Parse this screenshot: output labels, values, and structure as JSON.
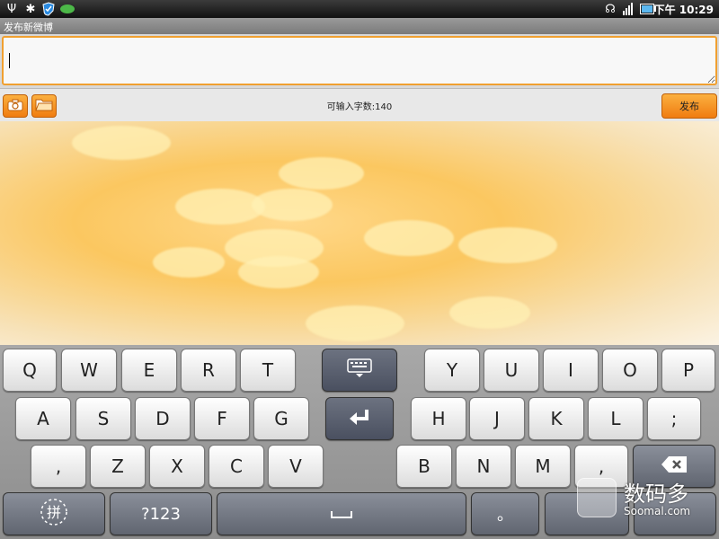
{
  "status_bar": {
    "left_icons": [
      "usb-icon",
      "bug-icon",
      "shield-icon",
      "leaf-icon"
    ],
    "right_icons": [
      "headset-icon",
      "signal-icon",
      "battery-icon"
    ],
    "time": "下午 10:29"
  },
  "title_bar": {
    "title": "发布新微博"
  },
  "compose": {
    "value": "",
    "placeholder": ""
  },
  "toolbar": {
    "camera_icon": "camera-icon",
    "folder_icon": "folder-icon",
    "char_count": "可输入字数:140",
    "publish_label": "发布"
  },
  "keyboard": {
    "row1": [
      "Q",
      "W",
      "E",
      "R",
      "T",
      "Y",
      "U",
      "I",
      "O",
      "P"
    ],
    "row2": [
      "A",
      "S",
      "D",
      "F",
      "G",
      "H",
      "J",
      "K",
      "L",
      ";"
    ],
    "row3": [
      ",",
      "Z",
      "X",
      "C",
      "V",
      "B",
      "N",
      "M",
      ","
    ],
    "symbols_label": "?123",
    "period_label": "。"
  },
  "watermark": {
    "text": "数码多",
    "sub": "Soomal.com"
  },
  "colors": {
    "accent": "#f08c20",
    "keyboard": "#9a9a9a"
  }
}
